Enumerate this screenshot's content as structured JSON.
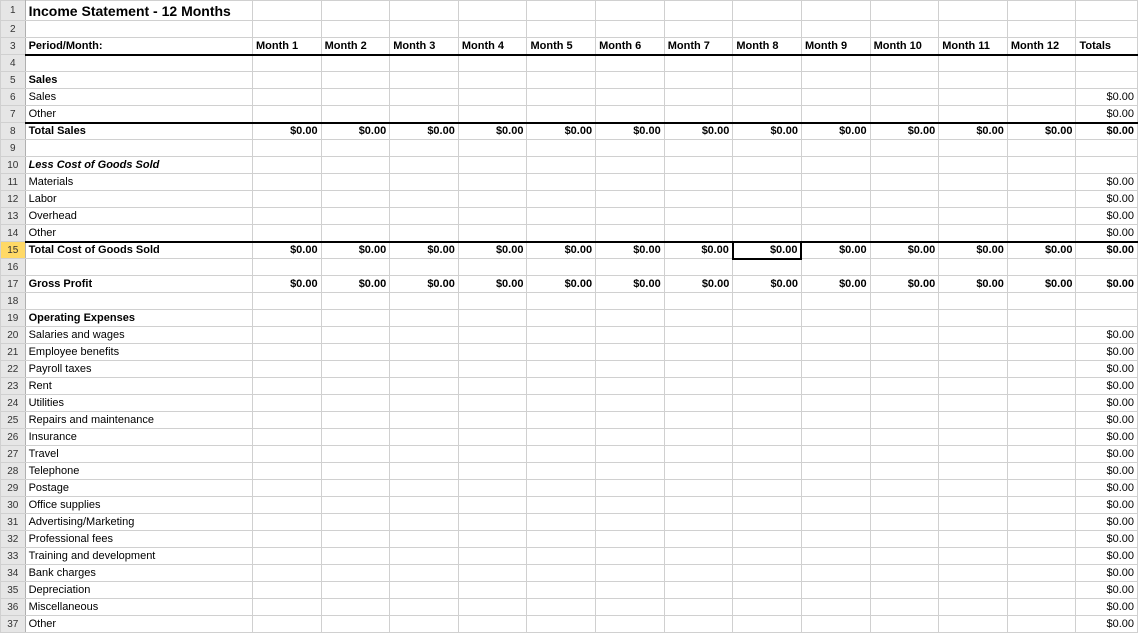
{
  "title": "Income Statement - 12 Months",
  "headers": {
    "period": "Period/Month:",
    "months": [
      "Month 1",
      "Month 2",
      "Month 3",
      "Month 4",
      "Month 5",
      "Month 6",
      "Month 7",
      "Month 8",
      "Month 9",
      "Month 10",
      "Month 11",
      "Month 12"
    ],
    "totals": "Totals"
  },
  "zero": "$0.00",
  "sections": {
    "salesHeader": "Sales",
    "salesItems": [
      "Sales",
      "Other"
    ],
    "totalSales": "Total Sales",
    "cogsHeader": "Less Cost of Goods Sold",
    "cogsItems": [
      "Materials",
      "Labor",
      "Overhead",
      "Other"
    ],
    "totalCogs": "Total Cost of Goods Sold",
    "grossProfit": "Gross Profit",
    "opexHeader": "Operating Expenses",
    "opexItems": [
      "Salaries and wages",
      "Employee benefits",
      "Payroll taxes",
      "Rent",
      "Utilities",
      "Repairs and maintenance",
      "Insurance",
      "Travel",
      "Telephone",
      "Postage",
      "Office supplies",
      "Advertising/Marketing",
      "Professional fees",
      "Training and development",
      "Bank charges",
      "Depreciation",
      "Miscellaneous",
      "Other"
    ]
  },
  "rowNumbers": [
    1,
    2,
    3,
    4,
    5,
    6,
    7,
    8,
    9,
    10,
    11,
    12,
    13,
    14,
    15,
    16,
    17,
    18,
    19,
    20,
    21,
    22,
    23,
    24,
    25,
    26,
    27,
    28,
    29,
    30,
    31,
    32,
    33,
    34,
    35,
    36,
    37
  ],
  "activeCell": {
    "row": 15,
    "col": 8
  }
}
